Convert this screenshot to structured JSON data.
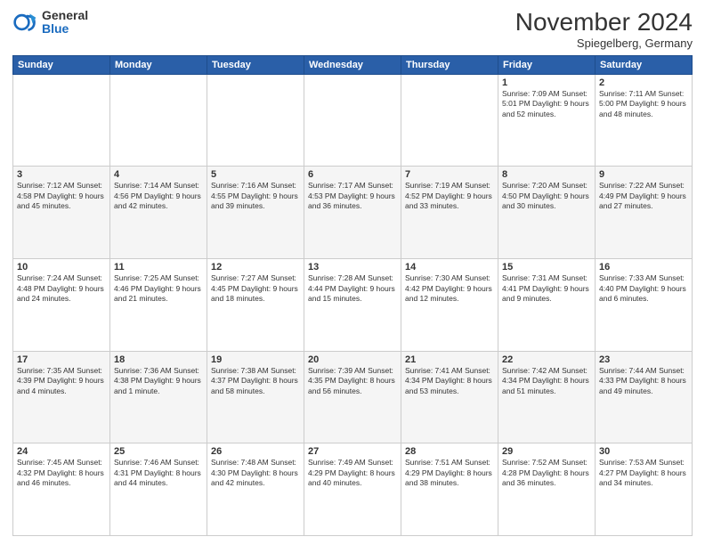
{
  "logo": {
    "general": "General",
    "blue": "Blue"
  },
  "header": {
    "month": "November 2024",
    "location": "Spiegelberg, Germany"
  },
  "weekdays": [
    "Sunday",
    "Monday",
    "Tuesday",
    "Wednesday",
    "Thursday",
    "Friday",
    "Saturday"
  ],
  "weeks": [
    [
      {
        "day": "",
        "info": ""
      },
      {
        "day": "",
        "info": ""
      },
      {
        "day": "",
        "info": ""
      },
      {
        "day": "",
        "info": ""
      },
      {
        "day": "",
        "info": ""
      },
      {
        "day": "1",
        "info": "Sunrise: 7:09 AM\nSunset: 5:01 PM\nDaylight: 9 hours and 52 minutes."
      },
      {
        "day": "2",
        "info": "Sunrise: 7:11 AM\nSunset: 5:00 PM\nDaylight: 9 hours and 48 minutes."
      }
    ],
    [
      {
        "day": "3",
        "info": "Sunrise: 7:12 AM\nSunset: 4:58 PM\nDaylight: 9 hours and 45 minutes."
      },
      {
        "day": "4",
        "info": "Sunrise: 7:14 AM\nSunset: 4:56 PM\nDaylight: 9 hours and 42 minutes."
      },
      {
        "day": "5",
        "info": "Sunrise: 7:16 AM\nSunset: 4:55 PM\nDaylight: 9 hours and 39 minutes."
      },
      {
        "day": "6",
        "info": "Sunrise: 7:17 AM\nSunset: 4:53 PM\nDaylight: 9 hours and 36 minutes."
      },
      {
        "day": "7",
        "info": "Sunrise: 7:19 AM\nSunset: 4:52 PM\nDaylight: 9 hours and 33 minutes."
      },
      {
        "day": "8",
        "info": "Sunrise: 7:20 AM\nSunset: 4:50 PM\nDaylight: 9 hours and 30 minutes."
      },
      {
        "day": "9",
        "info": "Sunrise: 7:22 AM\nSunset: 4:49 PM\nDaylight: 9 hours and 27 minutes."
      }
    ],
    [
      {
        "day": "10",
        "info": "Sunrise: 7:24 AM\nSunset: 4:48 PM\nDaylight: 9 hours and 24 minutes."
      },
      {
        "day": "11",
        "info": "Sunrise: 7:25 AM\nSunset: 4:46 PM\nDaylight: 9 hours and 21 minutes."
      },
      {
        "day": "12",
        "info": "Sunrise: 7:27 AM\nSunset: 4:45 PM\nDaylight: 9 hours and 18 minutes."
      },
      {
        "day": "13",
        "info": "Sunrise: 7:28 AM\nSunset: 4:44 PM\nDaylight: 9 hours and 15 minutes."
      },
      {
        "day": "14",
        "info": "Sunrise: 7:30 AM\nSunset: 4:42 PM\nDaylight: 9 hours and 12 minutes."
      },
      {
        "day": "15",
        "info": "Sunrise: 7:31 AM\nSunset: 4:41 PM\nDaylight: 9 hours and 9 minutes."
      },
      {
        "day": "16",
        "info": "Sunrise: 7:33 AM\nSunset: 4:40 PM\nDaylight: 9 hours and 6 minutes."
      }
    ],
    [
      {
        "day": "17",
        "info": "Sunrise: 7:35 AM\nSunset: 4:39 PM\nDaylight: 9 hours and 4 minutes."
      },
      {
        "day": "18",
        "info": "Sunrise: 7:36 AM\nSunset: 4:38 PM\nDaylight: 9 hours and 1 minute."
      },
      {
        "day": "19",
        "info": "Sunrise: 7:38 AM\nSunset: 4:37 PM\nDaylight: 8 hours and 58 minutes."
      },
      {
        "day": "20",
        "info": "Sunrise: 7:39 AM\nSunset: 4:35 PM\nDaylight: 8 hours and 56 minutes."
      },
      {
        "day": "21",
        "info": "Sunrise: 7:41 AM\nSunset: 4:34 PM\nDaylight: 8 hours and 53 minutes."
      },
      {
        "day": "22",
        "info": "Sunrise: 7:42 AM\nSunset: 4:34 PM\nDaylight: 8 hours and 51 minutes."
      },
      {
        "day": "23",
        "info": "Sunrise: 7:44 AM\nSunset: 4:33 PM\nDaylight: 8 hours and 49 minutes."
      }
    ],
    [
      {
        "day": "24",
        "info": "Sunrise: 7:45 AM\nSunset: 4:32 PM\nDaylight: 8 hours and 46 minutes."
      },
      {
        "day": "25",
        "info": "Sunrise: 7:46 AM\nSunset: 4:31 PM\nDaylight: 8 hours and 44 minutes."
      },
      {
        "day": "26",
        "info": "Sunrise: 7:48 AM\nSunset: 4:30 PM\nDaylight: 8 hours and 42 minutes."
      },
      {
        "day": "27",
        "info": "Sunrise: 7:49 AM\nSunset: 4:29 PM\nDaylight: 8 hours and 40 minutes."
      },
      {
        "day": "28",
        "info": "Sunrise: 7:51 AM\nSunset: 4:29 PM\nDaylight: 8 hours and 38 minutes."
      },
      {
        "day": "29",
        "info": "Sunrise: 7:52 AM\nSunset: 4:28 PM\nDaylight: 8 hours and 36 minutes."
      },
      {
        "day": "30",
        "info": "Sunrise: 7:53 AM\nSunset: 4:27 PM\nDaylight: 8 hours and 34 minutes."
      }
    ]
  ]
}
